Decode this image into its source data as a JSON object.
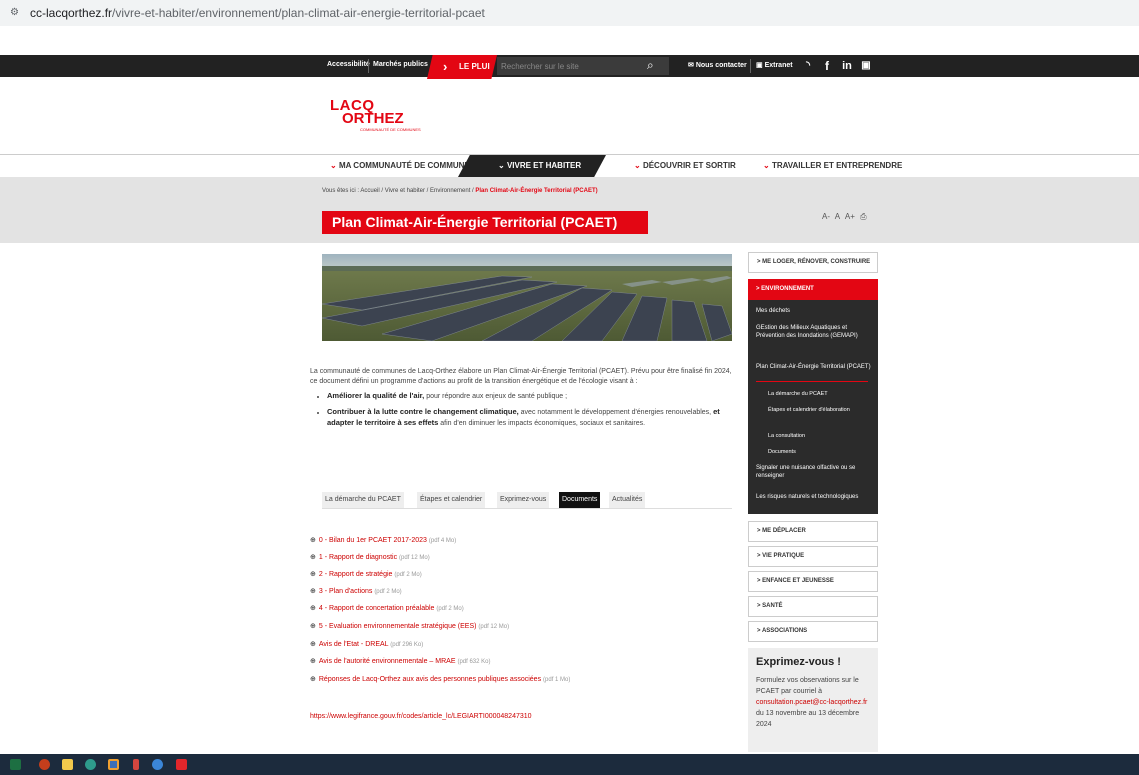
{
  "browser": {
    "url_host": "cc-lacqorthez.fr",
    "url_path": "/vivre-et-habiter/environnement/plan-climat-air-energie-territorial-pcaet"
  },
  "topbar": {
    "accessibilite": "Accessibilité",
    "marches": "Marchés publics",
    "leplui": "LE PLUI",
    "search_placeholder": "Rechercher sur le site",
    "contact": "Nous contacter",
    "extranet": "Extranet",
    "social": [
      "rss-icon",
      "facebook-icon",
      "linkedin-icon",
      "youtube-icon"
    ]
  },
  "logo": {
    "line1": "LACQ",
    "line2": "ORTHEZ",
    "tagline": "COMMUNAUTÉ DE COMMUNES"
  },
  "nav": {
    "items": [
      "MA COMMUNAUTÉ DE COMMUNES",
      "VIVRE ET HABITER",
      "DÉCOUVRIR ET SORTIR",
      "TRAVAILLER ET ENTREPRENDRE"
    ],
    "active_index": 1
  },
  "breadcrumb": {
    "prefix": "Vous êtes ici :",
    "items": [
      "Accueil",
      "Vivre et habiter",
      "Environnement"
    ],
    "current": "Plan Climat-Air-Énergie Territorial (PCAET)"
  },
  "page": {
    "title": "Plan Climat-Air-Énergie Territorial (PCAET)",
    "font_controls": [
      "A-",
      "A",
      "A+"
    ]
  },
  "intro": {
    "paragraph": "La communauté de communes de Lacq-Orthez élabore un Plan Climat-Air-Énergie Territorial (PCAET). Prévu pour être finalisé fin 2024, ce document défini un programme d'actions  au profit de la transition énergétique et de l'écologie visant à :",
    "bullet1_bold": "Améliorer la qualité de l'air,",
    "bullet1_rest": " pour répondre aux enjeux de santé publique ;",
    "bullet2_bold": "Contribuer à la lutte contre le changement climatique,",
    "bullet2_mid": " avec notamment le développement d'énergies renouvelables,  ",
    "bullet2_bold2": "et adapter le  territoire à ses effets",
    "bullet2_end": "  afin d'en diminuer les impacts économiques, sociaux et sanitaires."
  },
  "tabs": [
    "La démarche du PCAET",
    "Étapes et calendrier",
    "Exprimez-vous",
    "Documents",
    "Actualités"
  ],
  "active_tab": 3,
  "documents": [
    {
      "label": "0 - Bilan du 1er PCAET 2017-2023",
      "size": "(pdf 4 Mo)"
    },
    {
      "label": "1 - Rapport de diagnostic",
      "size": "(pdf 12 Mo)"
    },
    {
      "label": "2 - Rapport de stratégie",
      "size": "(pdf 2 Mo)"
    },
    {
      "label": "3 - Plan d'actions",
      "size": "(pdf 2 Mo)"
    },
    {
      "label": "4 - Rapport de concertation préalable",
      "size": "(pdf 2 Mo)"
    },
    {
      "label": "5 - Evaluation environnementale stratégique (EES)",
      "size": "(pdf 12 Mo)"
    },
    {
      "label": "Avis de l'Etat - DREAL",
      "size": "(pdf 296 Ko)"
    },
    {
      "label": "Avis de l'autorité environnementale – MRAE",
      "size": "(pdf 632 Ko)"
    },
    {
      "label": "Réponses de Lacq-Orthez aux avis des personnes publiques associées",
      "size": "(pdf 1 Mo)"
    }
  ],
  "legifrance_link": "https://www.legifrance.gouv.fr/codes/article_lc/LEGIARTI000048247310",
  "sidebar": {
    "loger": "> ME LOGER, RÉNOVER, CONSTRUIRE",
    "environnement": "> ENVIRONNEMENT",
    "menu": {
      "dechets": "Mes déchets",
      "gemapi": "GEstion des Milieux Aquatiques et Prévention des Inondations (GEMAPI)",
      "pcaet": "Plan Climat-Air-Énergie Territorial (PCAET)",
      "sub1": "La démarche du PCAET",
      "sub2": "Étapes et calendrier d'élaboration",
      "sub3": "La consultation",
      "sub4": "Documents",
      "nuisance": "Signaler une nuisance olfactive ou se renseigner",
      "risques": "Les risques naturels et technologiques"
    },
    "deplacer": "> ME DÉPLACER",
    "vie": "> VIE PRATIQUE",
    "enfance": "> ENFANCE ET JEUNESSE",
    "sante": "> SANTÉ",
    "associations": "> ASSOCIATIONS",
    "exprimez_title": "Exprimez-vous !",
    "exprimez_text1": "Formulez vos observations sur le PCAET par courriel à",
    "exprimez_mail": "consultation.pcaet@cc-lacqorthez.fr",
    "exprimez_text2": " du 13 novembre au 13 décembre 2024"
  },
  "colors": {
    "brand_red": "#e30613",
    "dark": "#222222",
    "band": "#e3e3e3"
  }
}
